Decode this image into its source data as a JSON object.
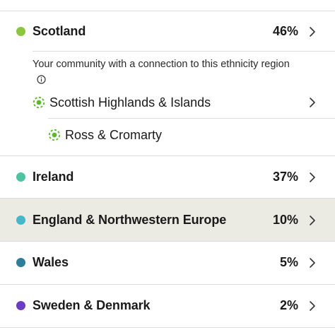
{
  "regions": [
    {
      "name": "Scotland",
      "percent": "46%",
      "color": "#8cc63f"
    },
    {
      "name": "Ireland",
      "percent": "37%",
      "color": "#4fc3a1"
    },
    {
      "name": "England & Northwestern Europe",
      "percent": "10%",
      "color": "#45b7c9",
      "highlighted": true
    },
    {
      "name": "Wales",
      "percent": "5%",
      "color": "#2e7d9a"
    },
    {
      "name": "Sweden & Denmark",
      "percent": "2%",
      "color": "#6a3ec2"
    }
  ],
  "community": {
    "label": "Your community with a connection to this ethnicity region",
    "items": [
      {
        "name": "Scottish Highlands & Islands",
        "color": "#5cb82e"
      },
      {
        "name": "Ross & Cromarty",
        "color": "#5cb82e"
      }
    ]
  },
  "icons": {
    "chevron": "chevron-right-icon",
    "info": "info-icon",
    "community": "community-ring-icon"
  }
}
